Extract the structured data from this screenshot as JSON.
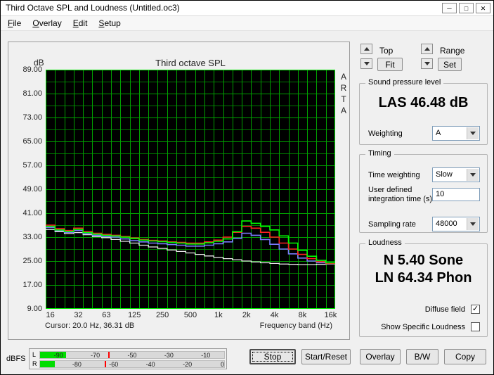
{
  "window": {
    "title": "Third Octave SPL and Loudness (Untitled.oc3)",
    "controls": {
      "minimize": "─",
      "maximize": "□",
      "close": "✕"
    }
  },
  "menu": {
    "items": [
      {
        "label": "File"
      },
      {
        "label": "Overlay"
      },
      {
        "label": "Edit"
      },
      {
        "label": "Setup"
      }
    ]
  },
  "toolbar": {
    "top_label": "Top",
    "fit_label": "Fit",
    "range_label": "Range",
    "set_label": "Set"
  },
  "spl_group": {
    "title": "Sound pressure level",
    "value": "LAS 46.48 dB",
    "weighting_label": "Weighting",
    "weighting_value": "A"
  },
  "timing_group": {
    "title": "Timing",
    "time_weighting_label": "Time weighting",
    "time_weighting_value": "Slow",
    "integration_label_1": "User defined",
    "integration_label_2": "integration time (s)",
    "integration_value": "10",
    "sampling_label": "Sampling rate",
    "sampling_value": "48000"
  },
  "loudness_group": {
    "title": "Loudness",
    "n_value": "N 5.40 Sone",
    "ln_value": "LN 64.34 Phon",
    "diffuse_label": "Diffuse field",
    "diffuse_checked": true,
    "specific_label": "Show Specific Loudness",
    "specific_checked": false
  },
  "chart": {
    "db_label": "dB",
    "title": "Third octave SPL",
    "watermark": [
      "A",
      "R",
      "T",
      "A"
    ],
    "y_ticks": [
      "89.00",
      "81.00",
      "73.00",
      "65.00",
      "57.00",
      "49.00",
      "41.00",
      "33.00",
      "25.00",
      "17.00",
      "9.00"
    ],
    "x_ticks": [
      "16",
      "32",
      "63",
      "125",
      "250",
      "500",
      "1k",
      "2k",
      "4k",
      "8k",
      "16k"
    ],
    "xlabel": "Frequency band (Hz)",
    "cursor_text": "Cursor:   20.0 Hz, 36.31 dB",
    "grid_color": "#00A000",
    "grid_minor_color": "#007800",
    "border_color": "#00E800",
    "bg_color": "#000000"
  },
  "chart_data": {
    "type": "line",
    "subtype": "third-octave-step",
    "title": "Third octave SPL",
    "xlabel": "Frequency band (Hz)",
    "ylabel": "dB",
    "ylim": [
      9,
      89
    ],
    "bands": [
      16,
      20,
      25,
      31.5,
      40,
      50,
      63,
      80,
      100,
      125,
      160,
      200,
      250,
      315,
      400,
      500,
      630,
      800,
      1000,
      1250,
      1600,
      2000,
      2500,
      3150,
      4000,
      5000,
      6300,
      8000,
      10000,
      12500,
      16000
    ],
    "series": [
      {
        "name": "trace-white",
        "color": "#e8e8e8",
        "values": [
          35.5,
          34.8,
          34.2,
          34.5,
          33.8,
          33.2,
          32.8,
          32.2,
          31.6,
          31.0,
          30.3,
          29.7,
          29.2,
          28.7,
          28.2,
          27.7,
          27.2,
          26.7,
          26.2,
          25.8,
          25.4,
          25.0,
          24.7,
          24.4,
          24.2,
          24.0,
          23.9,
          23.8,
          23.8,
          23.9,
          24.0
        ]
      },
      {
        "name": "trace-blue",
        "color": "#7b7bff",
        "values": [
          36.2,
          35.2,
          34.6,
          35.2,
          34.2,
          33.6,
          33.2,
          33.0,
          32.4,
          31.8,
          31.4,
          31.0,
          30.8,
          30.5,
          30.3,
          30.0,
          30.0,
          30.3,
          30.8,
          31.4,
          32.6,
          34.3,
          33.6,
          32.2,
          30.6,
          29.0,
          27.4,
          26.0,
          25.0,
          24.4,
          24.1
        ]
      },
      {
        "name": "trace-red",
        "color": "#ff2020",
        "values": [
          37.0,
          35.8,
          35.2,
          36.0,
          34.8,
          34.3,
          33.9,
          33.6,
          33.2,
          32.7,
          32.2,
          31.9,
          31.7,
          31.4,
          31.2,
          31.0,
          31.0,
          31.4,
          32.0,
          33.0,
          34.6,
          36.6,
          36.0,
          34.6,
          33.0,
          31.0,
          29.0,
          27.2,
          25.8,
          24.8,
          24.2
        ]
      },
      {
        "name": "trace-green",
        "color": "#00ff00",
        "values": [
          36.6,
          35.4,
          34.9,
          35.6,
          34.5,
          34.0,
          33.6,
          33.4,
          33.0,
          32.5,
          32.0,
          31.7,
          31.5,
          31.2,
          31.0,
          30.7,
          30.7,
          31.1,
          31.6,
          32.4,
          34.8,
          38.4,
          37.6,
          36.6,
          35.4,
          33.4,
          31.0,
          28.6,
          26.6,
          25.2,
          24.4
        ]
      }
    ]
  },
  "meter": {
    "label": "dBFS",
    "min_db": -100,
    "rows": [
      {
        "channel": "L",
        "level_db": -86,
        "peak_db": -63,
        "ticks": [
          -90,
          -70,
          -50,
          -30,
          -10
        ]
      },
      {
        "channel": "R",
        "level_db": -92,
        "peak_db": -65,
        "ticks": [
          -80,
          -60,
          -40,
          -20,
          0
        ]
      }
    ]
  },
  "buttons": {
    "stop": "Stop",
    "start_reset": "Start/Reset",
    "overlay": "Overlay",
    "bw": "B/W",
    "copy": "Copy"
  }
}
